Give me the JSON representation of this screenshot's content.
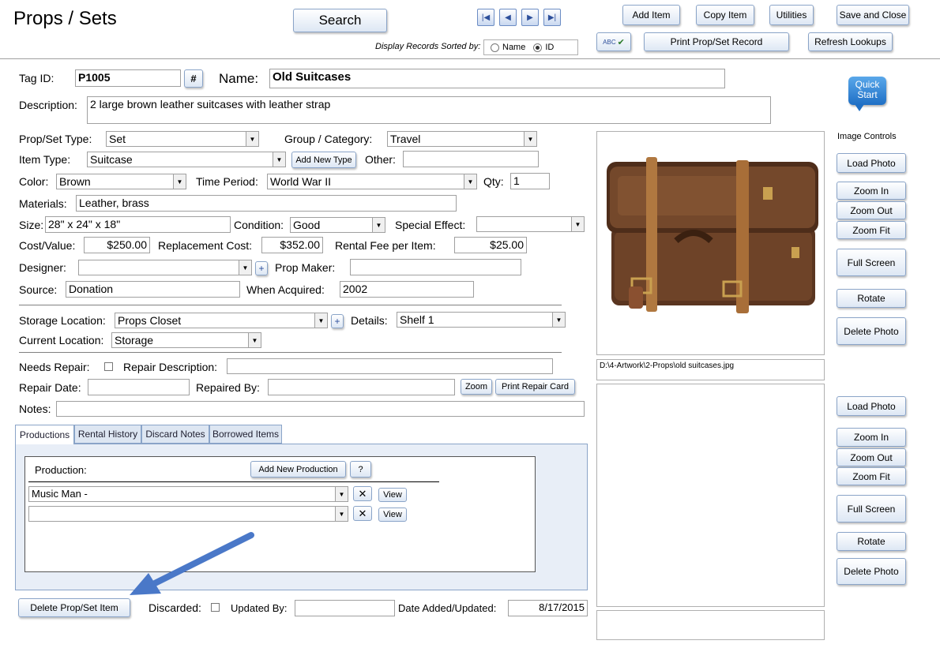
{
  "header": {
    "title": "Props / Sets",
    "search_label": "Search",
    "sort_label": "Display Records Sorted by:",
    "sort_options": [
      "Name",
      "ID"
    ],
    "buttons": {
      "add_item": "Add Item",
      "copy_item": "Copy Item",
      "utilities": "Utilities",
      "save_close": "Save and Close",
      "print_record": "Print Prop/Set Record",
      "refresh_lookups": "Refresh Lookups",
      "spell_check": "ABC"
    }
  },
  "quick_start": "Quick Start",
  "form": {
    "tag_id_label": "Tag ID:",
    "tag_id": "P1005",
    "hash_button": "#",
    "name_label": "Name:",
    "name": "Old Suitcases",
    "description_label": "Description:",
    "description": "2 large brown leather suitcases with leather strap",
    "type_label": "Prop/Set Type:",
    "type": "Set",
    "group_label": "Group / Category:",
    "group": "Travel",
    "item_type_label": "Item Type:",
    "item_type": "Suitcase",
    "add_type_button": "Add New Type",
    "other_label": "Other:",
    "other": "",
    "color_label": "Color:",
    "color": "Brown",
    "time_period_label": "Time Period:",
    "time_period": "World War II",
    "qty_label": "Qty:",
    "qty": "1",
    "materials_label": "Materials:",
    "materials": "Leather, brass",
    "size_label": "Size:",
    "size": "28\" x 24\" x 18\"",
    "condition_label": "Condition:",
    "condition": "Good",
    "special_effect_label": "Special Effect:",
    "special_effect": "",
    "cost_label": "Cost/Value:",
    "cost": "$250.00",
    "replacement_label": "Replacement Cost:",
    "replacement": "$352.00",
    "rental_label": "Rental Fee per Item:",
    "rental": "$25.00",
    "designer_label": "Designer:",
    "designer": "",
    "plus": "+",
    "prop_maker_label": "Prop Maker:",
    "prop_maker": "",
    "source_label": "Source:",
    "source": "Donation",
    "acquired_label": "When Acquired:",
    "acquired": "2002",
    "storage_label": "Storage Location:",
    "storage": "Props Closet",
    "details_label": "Details:",
    "details": "Shelf 1",
    "current_label": "Current Location:",
    "current": "Storage",
    "needs_repair_label": "Needs Repair:",
    "repair_desc_label": "Repair Description:",
    "repair_desc": "",
    "repair_date_label": "Repair Date:",
    "repair_date": "",
    "repaired_by_label": "Repaired By:",
    "repaired_by": "",
    "zoom_button": "Zoom",
    "print_repair_button": "Print Repair Card",
    "notes_label": "Notes:",
    "notes": ""
  },
  "tabs": [
    "Productions",
    "Rental History",
    "Discard Notes",
    "Borrowed Items"
  ],
  "productions": {
    "label": "Production:",
    "add_button": "Add New Production",
    "help_button": "?",
    "rows": [
      "Music Man  -",
      ""
    ],
    "view_label": "View",
    "remove_symbol": "✕"
  },
  "footer": {
    "delete_button": "Delete Prop/Set Item",
    "discarded_label": "Discarded:",
    "updated_by_label": "Updated By:",
    "updated_by": "",
    "date_label": "Date Added/Updated:",
    "date": "8/17/2015"
  },
  "image_controls": {
    "title": "Image Controls",
    "load": "Load Photo",
    "zoom_in": "Zoom In",
    "zoom_out": "Zoom Out",
    "zoom_fit": "Zoom Fit",
    "full_screen": "Full Screen",
    "rotate": "Rotate",
    "delete": "Delete Photo",
    "path1": "D:\\4-Artwork\\2-Props\\old suitcases.jpg",
    "path2": ""
  },
  "colors": {
    "button_border": "#8aa4c8",
    "panel_bg": "#e8eef7",
    "arrow": "#4a78c8"
  }
}
